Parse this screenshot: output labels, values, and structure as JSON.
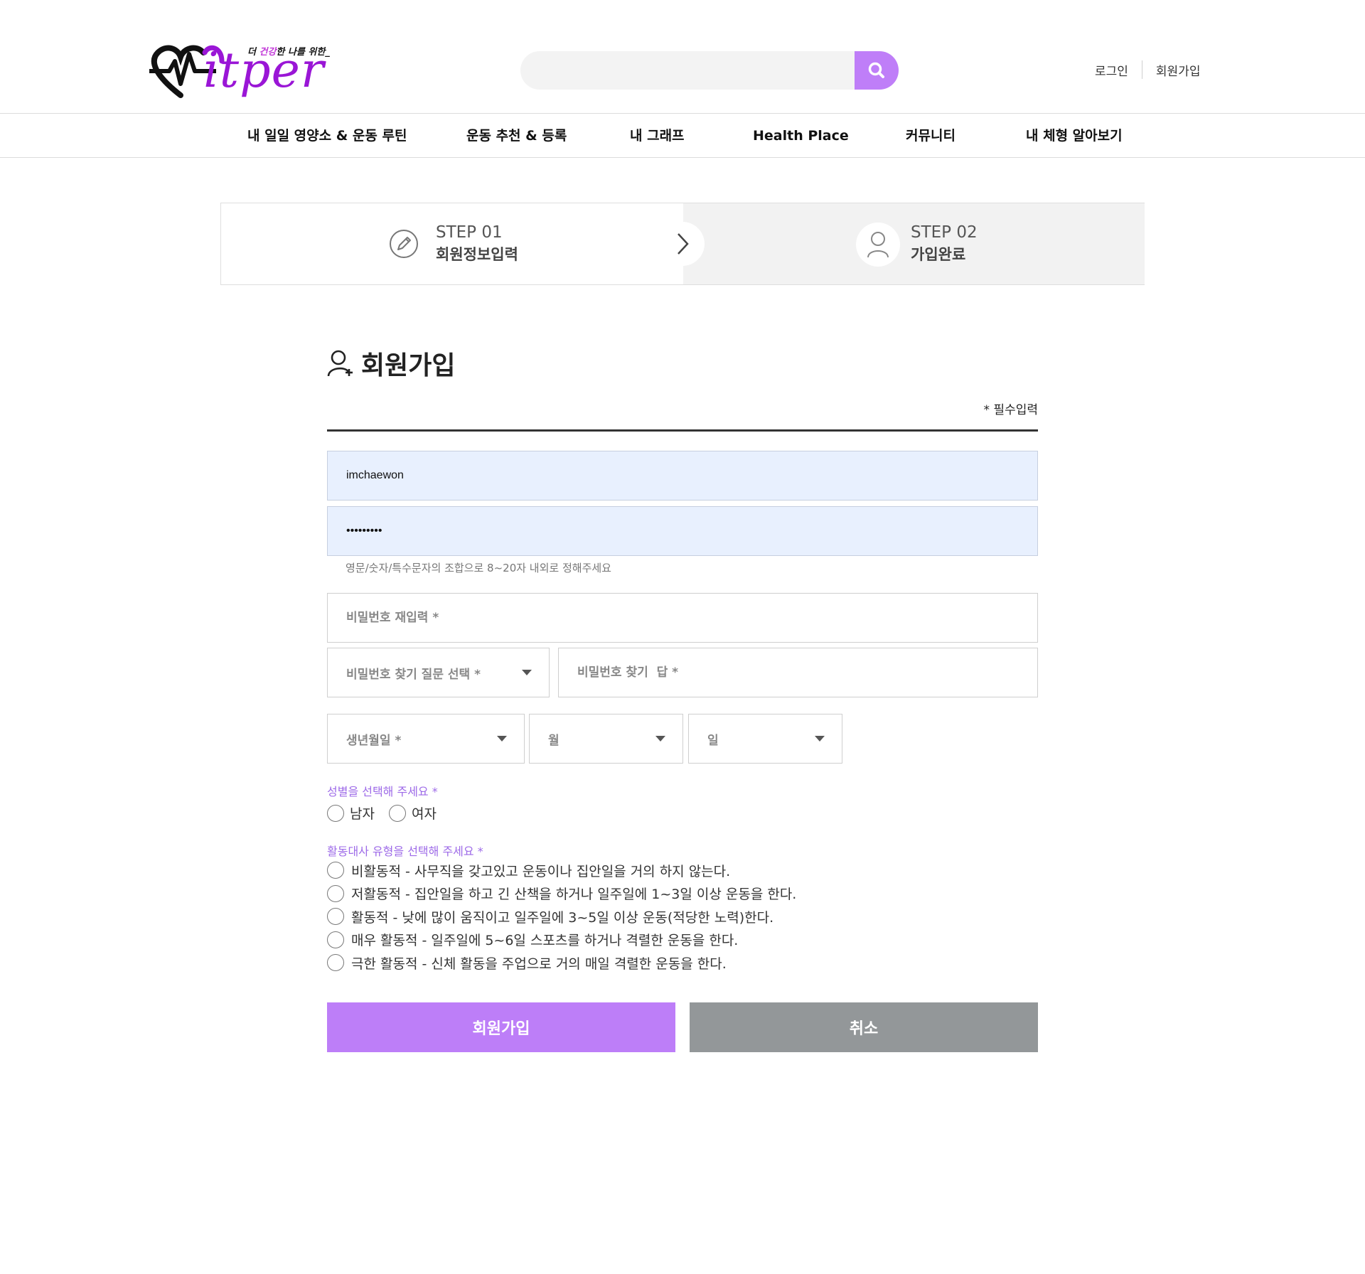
{
  "header": {
    "logo": {
      "tagline_pre": "더 ",
      "tagline_accent": "건강",
      "tagline_post": "한 나를 위한_",
      "wordmark": "itper"
    },
    "search": {
      "placeholder": "",
      "value": ""
    },
    "util": {
      "login": "로그인",
      "signup": "회원가입"
    }
  },
  "nav": {
    "items": [
      {
        "label": "내 일일 영양소 & 운동 루틴"
      },
      {
        "label": "운동 추천 & 등록"
      },
      {
        "label": "내 그래프"
      },
      {
        "label": "Health Place"
      },
      {
        "label": "커뮤니티"
      },
      {
        "label": "내 체형 알아보기"
      }
    ]
  },
  "steps": [
    {
      "num": "STEP 01",
      "label": "회원정보입력",
      "active": true
    },
    {
      "num": "STEP 02",
      "label": "가입완료",
      "active": false
    }
  ],
  "form": {
    "title": "회원가입",
    "required_note": "* 필수입력",
    "username": {
      "value": "imchaewon"
    },
    "password": {
      "value": "•••••••••"
    },
    "password_hint": "영문/숫자/특수문자의 조합으로 8~20자 내외로 정해주세요",
    "password_confirm": {
      "placeholder": "비밀번호 재입력 *"
    },
    "recovery_question": {
      "selected": "비밀번호 찾기 질문 선택 *"
    },
    "recovery_answer": {
      "placeholder": "비밀번호 찾기  답 *"
    },
    "birth": {
      "year": "생년월일 *",
      "month": "월",
      "day": "일"
    },
    "gender": {
      "label": "성별을 선택해 주세요 *",
      "options": [
        "남자",
        "여자"
      ]
    },
    "activity": {
      "label": "활동대사 유형을 선택해 주세요 *",
      "options": [
        "비활동적 - 사무직을 갖고있고 운동이나 집안일을 거의 하지 않는다.",
        "저활동적 - 집안일을 하고 긴 산책을 하거나 일주일에 1~3일 이상 운동을 한다.",
        "활동적 - 낮에 많이 움직이고 일주일에 3~5일 이상 운동(적당한 노력)한다.",
        "매우 활동적 - 일주일에 5~6일 스포츠를 하거나 격렬한 운동을 한다.",
        "극한 활동적 - 신체 활동을 주업으로 거의 매일 격렬한 운동을 한다."
      ]
    },
    "submit_label": "회원가입",
    "cancel_label": "취소"
  },
  "colors": {
    "accent": "#bd7ef8",
    "label_purple": "#9d6ae8",
    "cancel_gray": "#939799",
    "logo_purple": "#9a16d6"
  }
}
